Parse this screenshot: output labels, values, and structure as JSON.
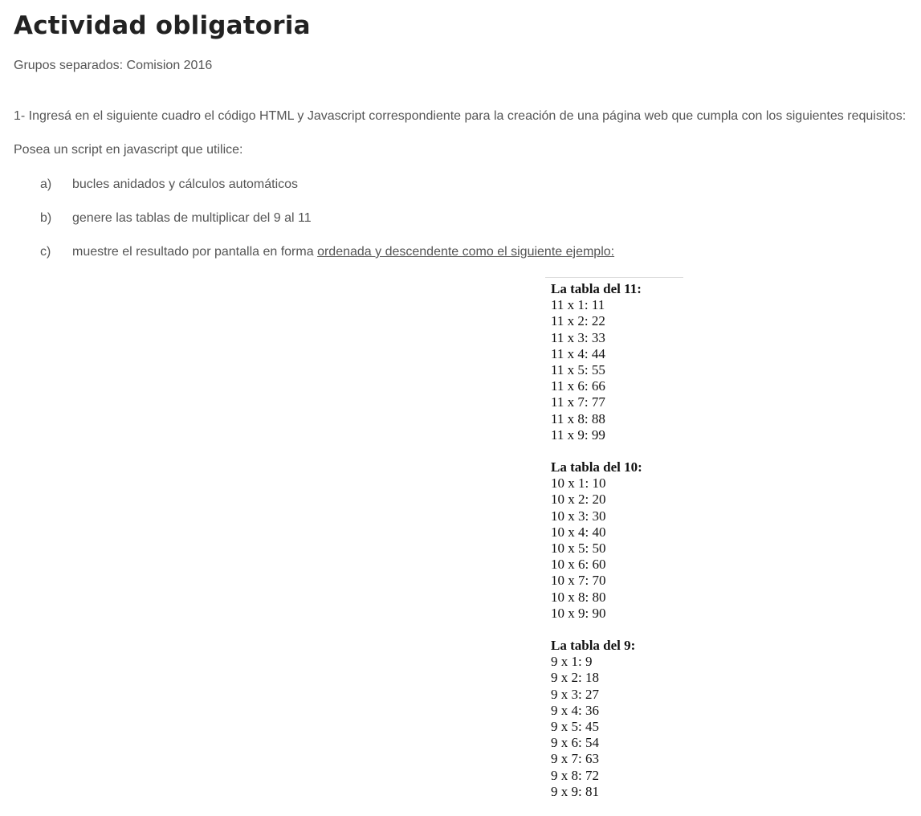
{
  "page": {
    "title": "Actividad obligatoria",
    "group_label": "Grupos separados: Comision 2016"
  },
  "instructions": {
    "intro": "1- Ingresá en el siguiente cuadro el código HTML y Javascript correspondiente para la creación de una página web que cumpla con los siguientes requisitos:",
    "subintro": "Posea un script en javascript que utilice:",
    "requirements": [
      {
        "marker": "a)",
        "text": "bucles anidados y cálculos automáticos"
      },
      {
        "marker": "b)",
        "text": "genere las tablas de multiplicar del 9 al 11"
      },
      {
        "marker": "c)",
        "text": "muestre el resultado por pantalla en forma ",
        "underlined": "ordenada y descendente como el siguiente ejemplo:"
      }
    ]
  },
  "example": {
    "tables": [
      {
        "title": "La tabla del 11:",
        "rows": [
          "11 x 1: 11",
          "11 x 2: 22",
          "11 x 3: 33",
          "11 x 4: 44",
          "11 x 5: 55",
          "11 x 6: 66",
          "11 x 7: 77",
          "11 x 8: 88",
          "11 x 9: 99"
        ]
      },
      {
        "title": "La tabla del 10:",
        "rows": [
          "10 x 1: 10",
          "10 x 2: 20",
          "10 x 3: 30",
          "10 x 4: 40",
          "10 x 5: 50",
          "10 x 6: 60",
          "10 x 7: 70",
          "10 x 8: 80",
          "10 x 9: 90"
        ]
      },
      {
        "title": "La tabla del 9:",
        "rows": [
          "9 x 1: 9",
          "9 x 2: 18",
          "9 x 3: 27",
          "9 x 4: 36",
          "9 x 5: 45",
          "9 x 6: 54",
          "9 x 7: 63",
          "9 x 8: 72",
          "9 x 9: 81"
        ]
      }
    ]
  }
}
